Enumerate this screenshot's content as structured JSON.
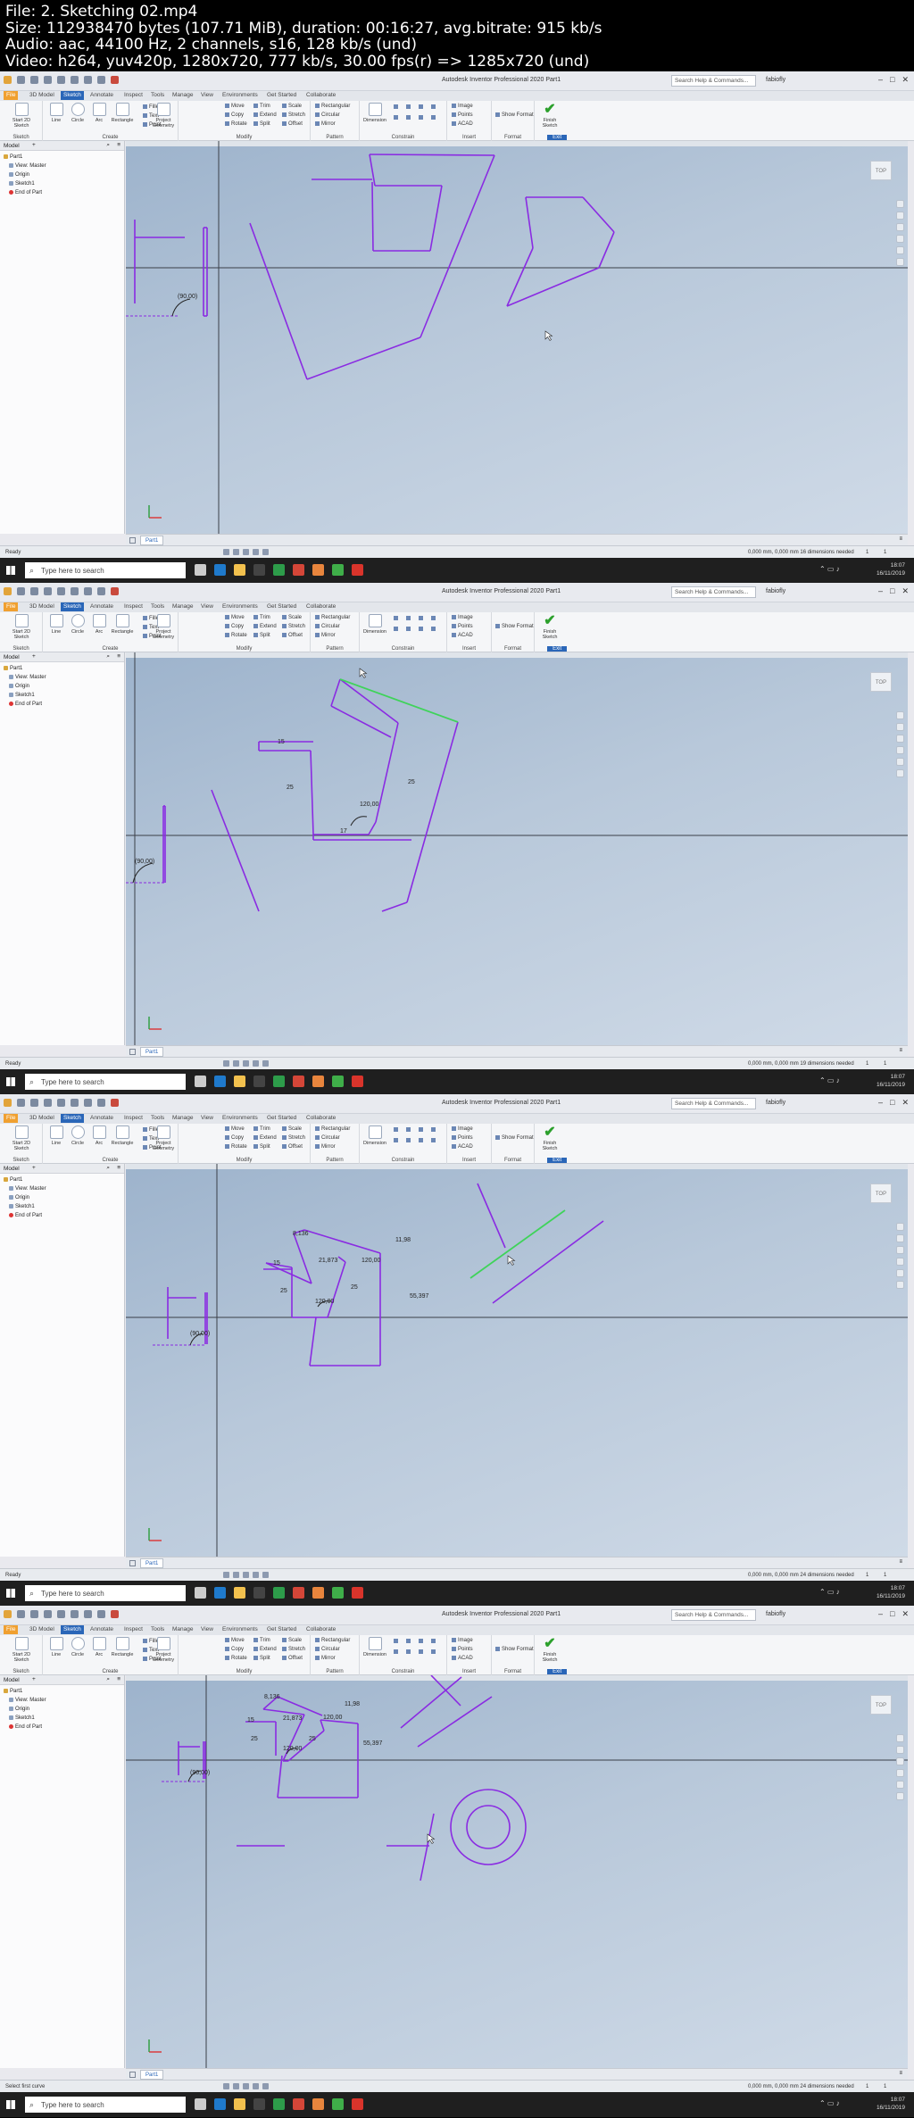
{
  "header": {
    "line1": "File: 2. Sketching 02.mp4",
    "line2": "Size: 112938470 bytes (107.71 MiB), duration: 00:16:27, avg.bitrate: 915 kb/s",
    "line3": "Audio: aac, 44100 Hz, 2 channels, s16, 128 kb/s (und)",
    "line4": "Video: h264, yuv420p, 1280x720, 777 kb/s, 30.00 fps(r) => 1285x720 (und)"
  },
  "window": {
    "app_title": "Autodesk Inventor Professional 2020   Part1",
    "search_placeholder": "Search Help & Commands...",
    "user": "fabiofly",
    "controls": [
      "–",
      "□",
      "✕"
    ]
  },
  "ribbon_tabs": [
    "File",
    "3D Model",
    "Sketch",
    "Annotate",
    "Inspect",
    "Tools",
    "Manage",
    "View",
    "Environments",
    "Get Started",
    "Collaborate"
  ],
  "ribbon": {
    "start_sketch": "Start 2D Sketch",
    "line": "Line",
    "circle": "Circle",
    "arc": "Arc",
    "rectangle": "Rectangle",
    "fillet": "Fillet",
    "text": "Text",
    "point": "Point",
    "project_geometry": "Project Geometry",
    "move": "Move",
    "copy": "Copy",
    "rotate": "Rotate",
    "trim": "Trim",
    "extend": "Extend",
    "split": "Split",
    "scale": "Scale",
    "stretch": "Stretch",
    "offset": "Offset",
    "rectangular": "Rectangular",
    "circular": "Circular",
    "mirror": "Mirror",
    "dimension": "Dimension",
    "image": "Image",
    "points": "Points",
    "acad": "ACAD",
    "show_format": "Show Format",
    "finish_sketch": "Finish Sketch",
    "groups": {
      "sketch": "Sketch",
      "create": "Create",
      "modify": "Modify",
      "pattern": "Pattern",
      "constrain": "Constrain",
      "insert": "Insert",
      "format": "Format",
      "exit": "Exit"
    }
  },
  "browser": {
    "title": "Model",
    "plus": "+",
    "items": [
      {
        "label": "Part1",
        "level": 0
      },
      {
        "label": "View: Master",
        "level": 1
      },
      {
        "label": "Origin",
        "level": 1
      },
      {
        "label": "Sketch1",
        "level": 1
      },
      {
        "label": "End of Part",
        "level": 1
      }
    ]
  },
  "viewcube_label": "TOP",
  "doc_tab": "Part1",
  "taskbar": {
    "search": "Type here to search",
    "app_colors": [
      "#cccccc",
      "#1f7acc",
      "#f2c14e",
      "#444444",
      "#2d9c4a",
      "#d44638",
      "#e8853d",
      "#3fae49",
      "#d9342b"
    ]
  },
  "frames": [
    {
      "status": "Ready",
      "info": "0,000 mm, 0,000 mm  16 dimensions needed",
      "page1": "1",
      "page2": "1",
      "clock_time": "18:07",
      "clock_date": "16/11/2019",
      "dims": {
        "angle": "(90,00)"
      }
    },
    {
      "status": "Ready",
      "info": "0,000 mm, 0,000 mm  19 dimensions needed",
      "page1": "1",
      "page2": "1",
      "clock_time": "18:07",
      "clock_date": "16/11/2019",
      "dims": {
        "angle": "(90,00)",
        "d15": "15",
        "d25": "25",
        "d25b": "25",
        "d120": "120,00",
        "d17": "17"
      }
    },
    {
      "status": "Ready",
      "info": "0,000 mm, 0,000 mm  24 dimensions needed",
      "page1": "1",
      "page2": "1",
      "clock_time": "18:07",
      "clock_date": "16/11/2019",
      "dims": {
        "angle": "(90,00)",
        "d15": "15",
        "d25": "25",
        "d25b": "25",
        "d120": "120,00",
        "d8": "8,136",
        "d21": "21,873",
        "d11": "11,98",
        "d120b": "120,00",
        "d55": "55,397"
      }
    },
    {
      "status": "Select first curve",
      "info": "0,000 mm, 0,000 mm  24 dimensions needed",
      "page1": "1",
      "page2": "1",
      "clock_time": "18:07",
      "clock_date": "16/11/2019",
      "dims": {
        "angle": "(90,00)",
        "d15": "15",
        "d25": "25",
        "d25b": "25",
        "d120": "120,00",
        "d8": "8,136",
        "d21": "21,873",
        "d11": "11,98",
        "d120b": "120,00",
        "d55": "55,397"
      }
    }
  ]
}
